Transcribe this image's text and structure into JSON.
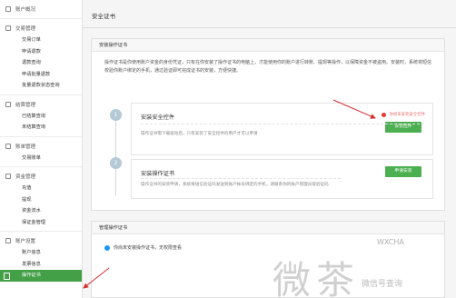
{
  "sidebar": {
    "groups": [
      {
        "title": "账户概况",
        "items": []
      },
      {
        "title": "交易管理",
        "items": [
          "交易订单",
          "申请退款",
          "退款查询",
          "申请批量退款",
          "批量退款状态查询"
        ]
      },
      {
        "title": "结算管理",
        "items": [
          "已结算查询",
          "未结算查询"
        ]
      },
      {
        "title": "账单管理",
        "items": [
          "交易账单"
        ]
      },
      {
        "title": "资金管理",
        "items": [
          "充值",
          "提现",
          "资金流水",
          "保证金管理"
        ]
      },
      {
        "title": "账户设置",
        "items": [
          "账户信息",
          "发票信息",
          "操作证书"
        ]
      }
    ],
    "active_item": "操作证书"
  },
  "page": {
    "title": "安全证书"
  },
  "install_panel": {
    "heading": "安装操作证书",
    "intro": "操作证书是你使用账户资金的身份凭证，只有在你安装了操作证书的电脑上，才能使用你的账户进行转账、提现等操作，以保障资金不被盗用。安装时，系统将短信校验你账户绑定的手机，通过验证即可完成证书的安装，方便快捷。",
    "steps": [
      {
        "number": "1",
        "title": "安装安全控件",
        "desc": "操作证书需下载驱动后，只有安装了安全控件的用户才可以申请",
        "warning": "你尚未安装安全控件",
        "button": "安装控件"
      },
      {
        "number": "2",
        "title": "安装操作证书",
        "desc": "操作证书的安装申请，系统将短信验证码发送到账户帐号绑定的手机，请联系你的账户管理员取验证码",
        "button": "申请安装"
      }
    ]
  },
  "manage_panel": {
    "heading": "管理操作证书",
    "info": "你尚未安装操作证书，无权限查看"
  },
  "watermark": {
    "top": "WXCHA",
    "main": "微茶",
    "sub": "微信号查询"
  },
  "colors": {
    "accent_green": "#4caf50",
    "sidebar_active": "#43a047",
    "warning_red": "#e53935",
    "info_blue": "#2196f3"
  }
}
